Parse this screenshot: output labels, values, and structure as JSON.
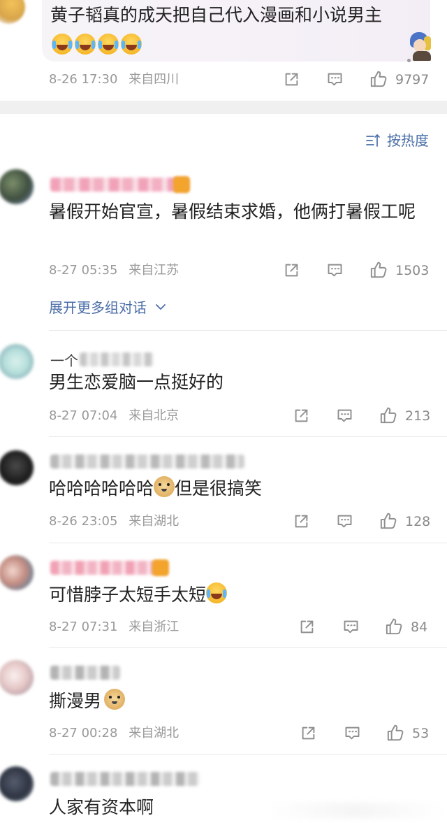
{
  "top_comment": {
    "text": "黄子韬真的成天把自己代入漫画和小说男主",
    "time": "8-26 17:30",
    "location": "来自四川",
    "likes": "9797"
  },
  "sort": {
    "label": "按热度",
    "icon": "sort-icon"
  },
  "comments": [
    {
      "text": "暑假开始官宣，暑假结束求婚，他俩打暑假工呢",
      "time": "8-27 05:35",
      "location": "来自江苏",
      "likes": "1503",
      "expand_label": "展开更多组对话"
    },
    {
      "username_prefix": "一个",
      "text": "男生恋爱脑一点挺好的",
      "time": "8-27 07:04",
      "location": "来自北京",
      "likes": "213"
    },
    {
      "text_before_emoji": "哈哈哈哈哈哈",
      "text_after_emoji": "但是很搞笑",
      "time": "8-26 23:05",
      "location": "来自湖北",
      "likes": "128"
    },
    {
      "text": "可惜脖子太短手太短",
      "time": "8-27 07:31",
      "location": "来自浙江",
      "likes": "84"
    },
    {
      "text": "撕漫男",
      "time": "8-27 00:28",
      "location": "来自湖北",
      "likes": "53"
    },
    {
      "text": "人家有资本啊"
    }
  ],
  "colors": {
    "link": "#4b6ea8",
    "meta": "#999999",
    "divider": "#f0f0f0"
  }
}
